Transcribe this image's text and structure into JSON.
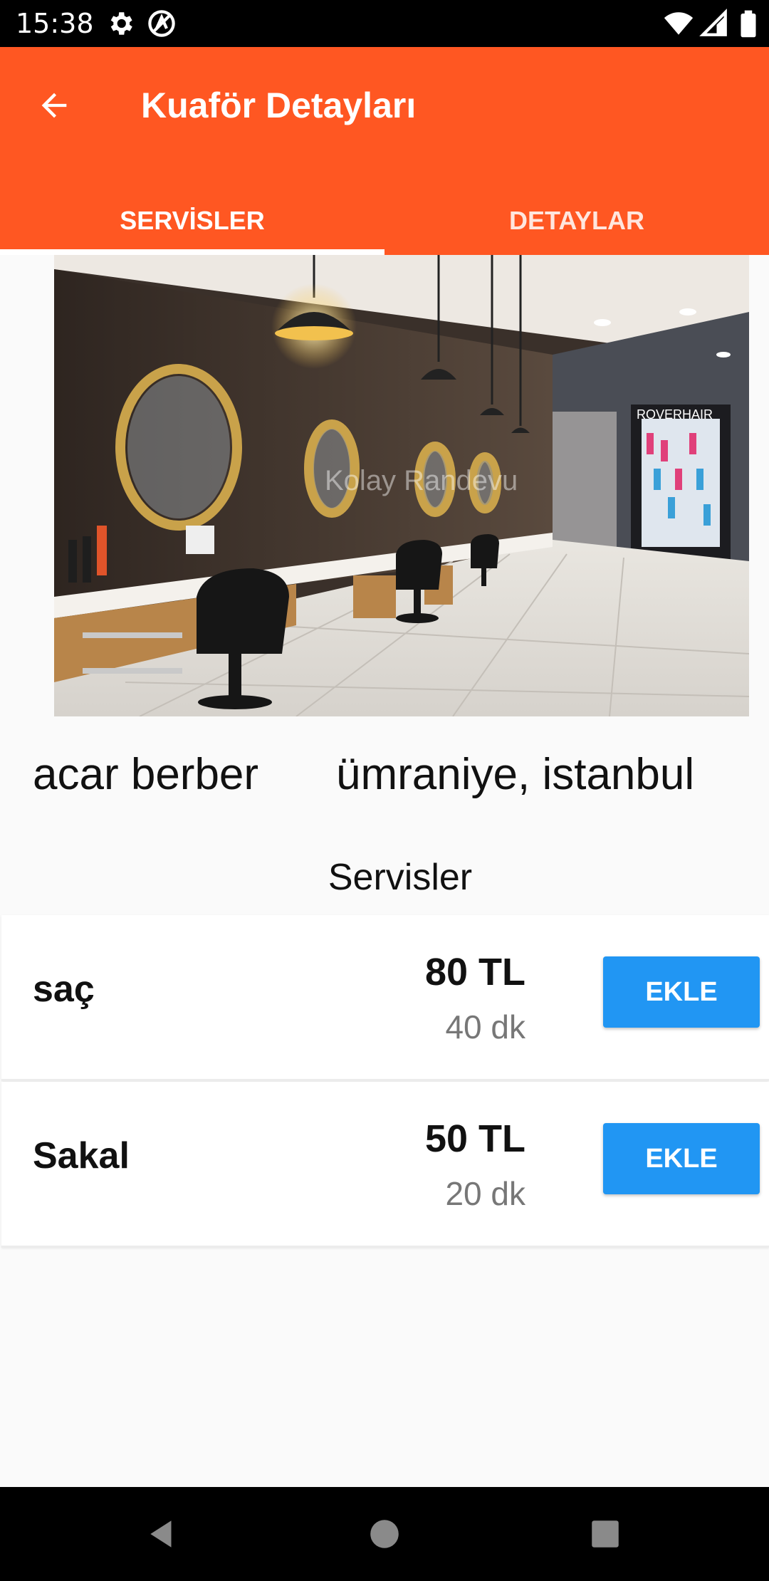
{
  "status_bar": {
    "time": "15:38",
    "icons": [
      "gear-icon",
      "circle-a-icon",
      "wifi-icon",
      "signal-icon",
      "battery-icon"
    ]
  },
  "app_bar": {
    "title": "Kuaför Detayları",
    "back_icon": "arrow-left-icon",
    "background_color": "#ff5722"
  },
  "tabs": [
    {
      "label": "SERVİSLER",
      "selected": true
    },
    {
      "label": "DETAYLAR",
      "selected": false
    }
  ],
  "salon": {
    "name": "acar berber",
    "location": "ümraniye, istanbul",
    "image_watermark": "Kolay Randevu",
    "image_sign": "ROVERHAIR"
  },
  "services_heading": "Servisler",
  "services": [
    {
      "name": "saç",
      "price": "80 TL",
      "duration": "40 dk",
      "button_label": "EKLE"
    },
    {
      "name": "Sakal",
      "price": "50 TL",
      "duration": "20 dk",
      "button_label": "EKLE"
    }
  ],
  "colors": {
    "accent": "#ff5722",
    "button": "#2196f3"
  },
  "nav_bar": {
    "icons": [
      "back-triangle-icon",
      "home-circle-icon",
      "recents-square-icon"
    ]
  }
}
